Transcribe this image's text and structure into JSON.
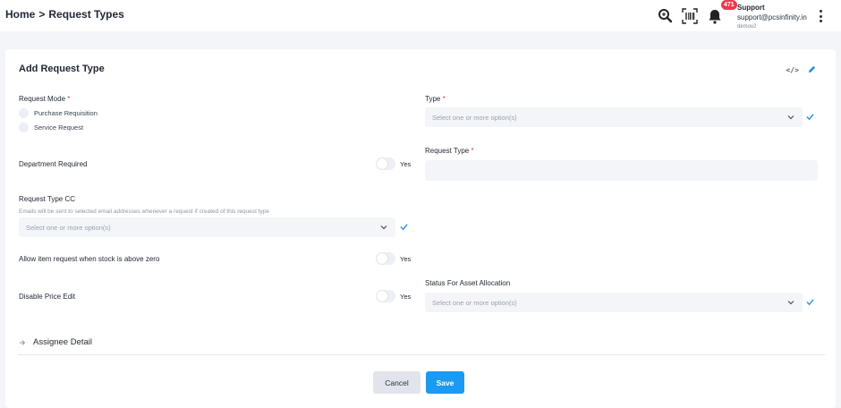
{
  "header": {
    "breadcrumb": [
      "Home",
      ">",
      "Request Types"
    ],
    "notification_count": "471",
    "user": {
      "name": "Support",
      "email": "support@pcsinfinity.in",
      "tenant": "demov2"
    },
    "icons": [
      "search-icon",
      "barcode-scanner-icon",
      "bell-icon",
      "kebab-menu-icon"
    ]
  },
  "card": {
    "title": "Add Request Type",
    "tools": [
      "code-icon",
      "edit-pencil-icon"
    ]
  },
  "form": {
    "request_mode": {
      "label": "Request Mode",
      "required_mark": "*",
      "options": [
        "Purchase Requisition",
        "Service Request"
      ]
    },
    "type": {
      "label": "Type",
      "required_mark": "*",
      "placeholder": "Select one or more option(s)"
    },
    "department_required": {
      "label": "Department Required",
      "toggle_label": "Yes",
      "value": false
    },
    "request_type": {
      "label": "Request Type",
      "required_mark": "*",
      "value": ""
    },
    "request_type_cc": {
      "label": "Request Type CC",
      "hint": "Emails will be sent to selected email addresses whenever a request if created of this request type",
      "placeholder": "Select one or more option(s)"
    },
    "allow_item_request": {
      "label": "Allow item request when stock is above zero",
      "toggle_label": "Yes",
      "value": false
    },
    "disable_price_edit": {
      "label": "Disable Price Edit",
      "toggle_label": "Yes",
      "value": false
    },
    "status_for_asset_allocation": {
      "label": "Status For Asset Allocation",
      "placeholder": "Select one or more option(s)"
    },
    "assignee_detail": {
      "label": "Assignee Detail"
    }
  },
  "actions": {
    "cancel_label": "Cancel",
    "save_label": "Save"
  },
  "colors": {
    "accent": "#1b9af2",
    "badge": "#ee3a4c",
    "required": "#e5394f",
    "check": "#1e90e6",
    "field_bg": "#f3f5f8"
  }
}
